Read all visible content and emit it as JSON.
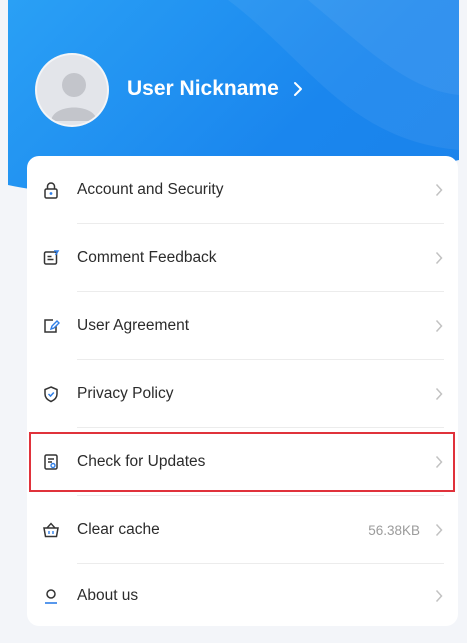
{
  "profile": {
    "nickname": "User Nickname",
    "chevron_icon": "chevron-right-icon",
    "avatar_icon": "default-user-avatar"
  },
  "colors": {
    "header_blue": "#1a86ee",
    "highlight_red": "#e0323b",
    "icon_blue": "#2f7fe8"
  },
  "menu": {
    "items": [
      {
        "label": "Account and Security",
        "icon": "lock-icon"
      },
      {
        "label": "Comment Feedback",
        "icon": "feedback-icon"
      },
      {
        "label": "User Agreement",
        "icon": "agreement-icon"
      },
      {
        "label": "Privacy Policy",
        "icon": "shield-icon"
      },
      {
        "label": "Check for Updates",
        "icon": "update-icon"
      },
      {
        "label": "Clear cache",
        "icon": "basket-icon",
        "value": "56.38KB"
      },
      {
        "label": "About us",
        "icon": "person-icon"
      }
    ]
  }
}
